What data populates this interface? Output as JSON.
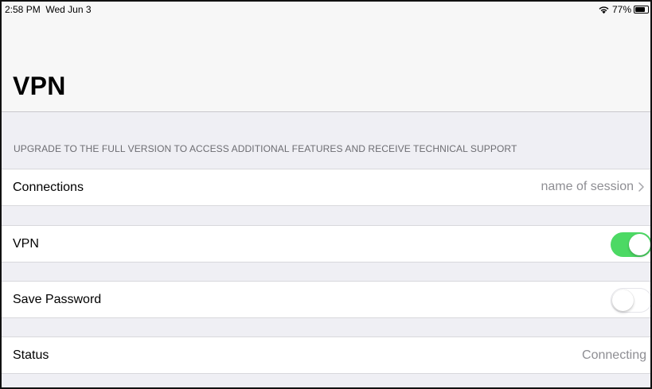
{
  "status_bar": {
    "time": "2:58 PM",
    "date": "Wed Jun 3",
    "battery_percent": "77%",
    "battery_level": 0.77,
    "wifi_icon": "wifi-icon",
    "battery_icon": "battery-icon"
  },
  "header": {
    "title": "VPN"
  },
  "notice": {
    "text": "UPGRADE TO THE FULL VERSION TO ACCESS ADDITIONAL FEATURES AND RECEIVE TECHNICAL SUPPORT"
  },
  "settings": {
    "connections": {
      "label": "Connections",
      "value": "name of session",
      "icon": "chevron-right-icon"
    },
    "vpn": {
      "label": "VPN",
      "enabled": true
    },
    "save_password": {
      "label": "Save Password",
      "enabled": false
    },
    "status": {
      "label": "Status",
      "value": "Connecting"
    }
  },
  "colors": {
    "toggle_on": "#4cd964",
    "background": "#efeff4",
    "secondary_text": "#8e8e93"
  }
}
